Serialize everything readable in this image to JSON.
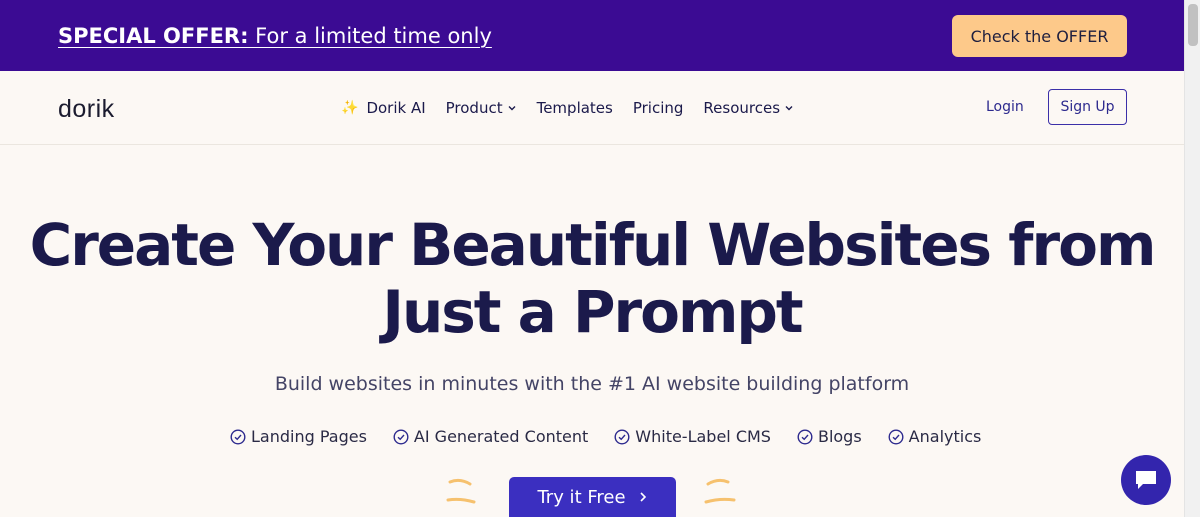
{
  "promo": {
    "strong": "SPECIAL OFFER:",
    "text": " For a limited time only",
    "button_label": "Check the OFFER"
  },
  "nav": {
    "logo": "dorik",
    "items": [
      {
        "label": "Dorik AI",
        "icon": "sparkle-icon"
      },
      {
        "label": "Product",
        "icon": "chevron-down-icon"
      },
      {
        "label": "Templates"
      },
      {
        "label": "Pricing"
      },
      {
        "label": "Resources",
        "icon": "chevron-down-icon"
      }
    ],
    "login_label": "Login",
    "signup_label": "Sign Up"
  },
  "hero": {
    "title_line1": "Create Your Beautiful Websites from",
    "title_line2": "Just a Prompt",
    "subtitle": "Build websites in minutes with the #1 AI website building platform",
    "features": [
      "Landing Pages",
      "AI Generated Content",
      "White-Label CMS",
      "Blogs",
      "Analytics"
    ],
    "cta_label": "Try it Free",
    "cta_icon": "chevron-right-icon"
  },
  "colors": {
    "promo_bg": "#3b0b93",
    "offer_button": "#fdc98a",
    "primary": "#3b2fc0",
    "heading": "#1b1a4b",
    "page_bg": "#fcf8f4"
  },
  "chat": {
    "icon": "chat-icon"
  }
}
